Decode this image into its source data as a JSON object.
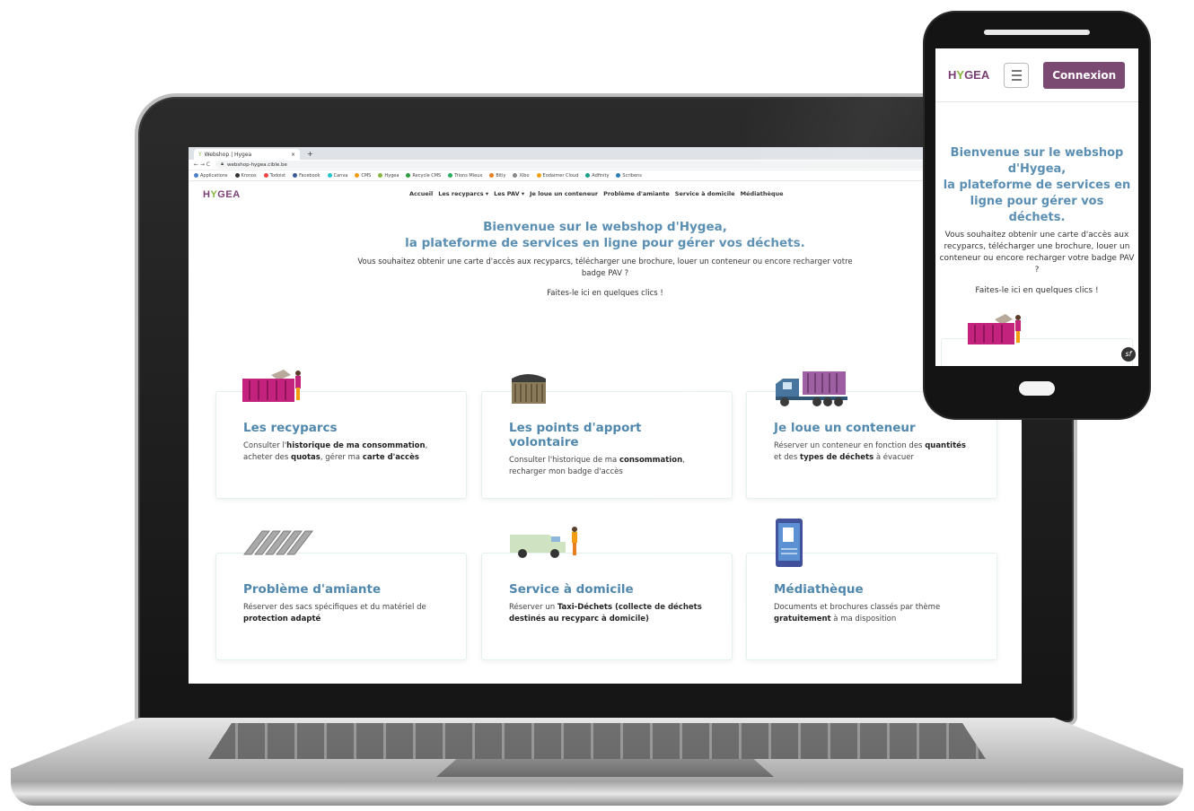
{
  "browser": {
    "tab_title": "Webshop | Hygea",
    "tab_close": "×",
    "tab_new": "+",
    "nav_buttons": "← → C",
    "url": "webshop-hygea.cible.be",
    "bookmarks": [
      "Applications",
      "Kronos",
      "Todoist",
      "Facebook",
      "Canva",
      "CMS",
      "Hygea",
      "Recycle CMS",
      "Trions Mieux",
      "Bitly",
      "Xibo",
      "Eodaimer Cloud",
      "Adfinity",
      "Scribens"
    ]
  },
  "site": {
    "logo": {
      "prefix": "H",
      "mid": "Y",
      "suffix": "GEA"
    },
    "nav": [
      "Accueil",
      "Les recyparcs ▾",
      "Les PAV ▾",
      "Je loue un conteneur",
      "Problème d'amiante",
      "Service à domicile",
      "Médiathèque"
    ],
    "hero": {
      "title_line1": "Bienvenue sur le webshop d'Hygea,",
      "title_line2": "la plateforme de services en ligne pour gérer vos déchets.",
      "text": "Vous souhaitez obtenir une carte d'accès aux recyparcs, télécharger une brochure, louer un conteneur ou encore recharger votre badge PAV ?",
      "cta": "Faites-le ici en quelques clics !"
    },
    "cards": [
      {
        "title": "Les recyparcs",
        "t1": "Consulter l'",
        "b1": "historique de ma consommation",
        "t2": ", acheter des ",
        "b2": "quotas",
        "t3": ", gérer ma ",
        "b3": "carte d'accès",
        "t4": ""
      },
      {
        "title": "Les points d'apport volontaire",
        "t1": "Consulter l'historique de ma ",
        "b1": "consommation",
        "t2": ", recharger mon badge d'accès",
        "b2": "",
        "t3": "",
        "b3": "",
        "t4": ""
      },
      {
        "title": "Je loue un conteneur",
        "t1": "Réserver un conteneur en fonction des ",
        "b1": "quantités",
        "t2": " et des ",
        "b2": "types de déchets",
        "t3": " à évacuer",
        "b3": "",
        "t4": ""
      },
      {
        "title": "Problème d'amiante",
        "t1": "Réserver des sacs spécifiques et du matériel de ",
        "b1": "protection adapté",
        "t2": "",
        "b2": "",
        "t3": "",
        "b3": "",
        "t4": ""
      },
      {
        "title": "Service à domicile",
        "t1": "Réserver un ",
        "b1": "Taxi-Déchets (collecte de déchets destinés au recyparc à domicile)",
        "t2": "",
        "b2": "",
        "t3": "",
        "b3": "",
        "t4": ""
      },
      {
        "title": "Médiathèque",
        "t1": "Documents et brochures classés par thème ",
        "b1": "gratuitement",
        "t2": " à ma disposition",
        "b2": "",
        "t3": "",
        "b3": "",
        "t4": ""
      }
    ]
  },
  "phone": {
    "login_label": "Connexion",
    "title_line1": "Bienvenue sur le webshop",
    "title_line2": "d'Hygea,",
    "title_line3": "la plateforme de services en",
    "title_line4": "ligne pour gérer vos déchets.",
    "text": "Vous souhaitez obtenir une carte d'accès aux recyparcs, télécharger une brochure, louer un conteneur ou encore recharger votre badge PAV ?",
    "cta": "Faites-le ici en quelques clics !",
    "sf_badge": "sf"
  },
  "colors": {
    "brand_purple": "#7b3e73",
    "brand_green": "#84b53c",
    "title_blue": "#5a8fb3",
    "button_purple": "#7b4a73"
  },
  "icons": [
    "container-icon",
    "pav-bin-icon",
    "truck-icon",
    "asbestos-sheets-icon",
    "van-icon",
    "brochure-phone-icon",
    "hamburger-icon",
    "symfony-badge-icon"
  ]
}
